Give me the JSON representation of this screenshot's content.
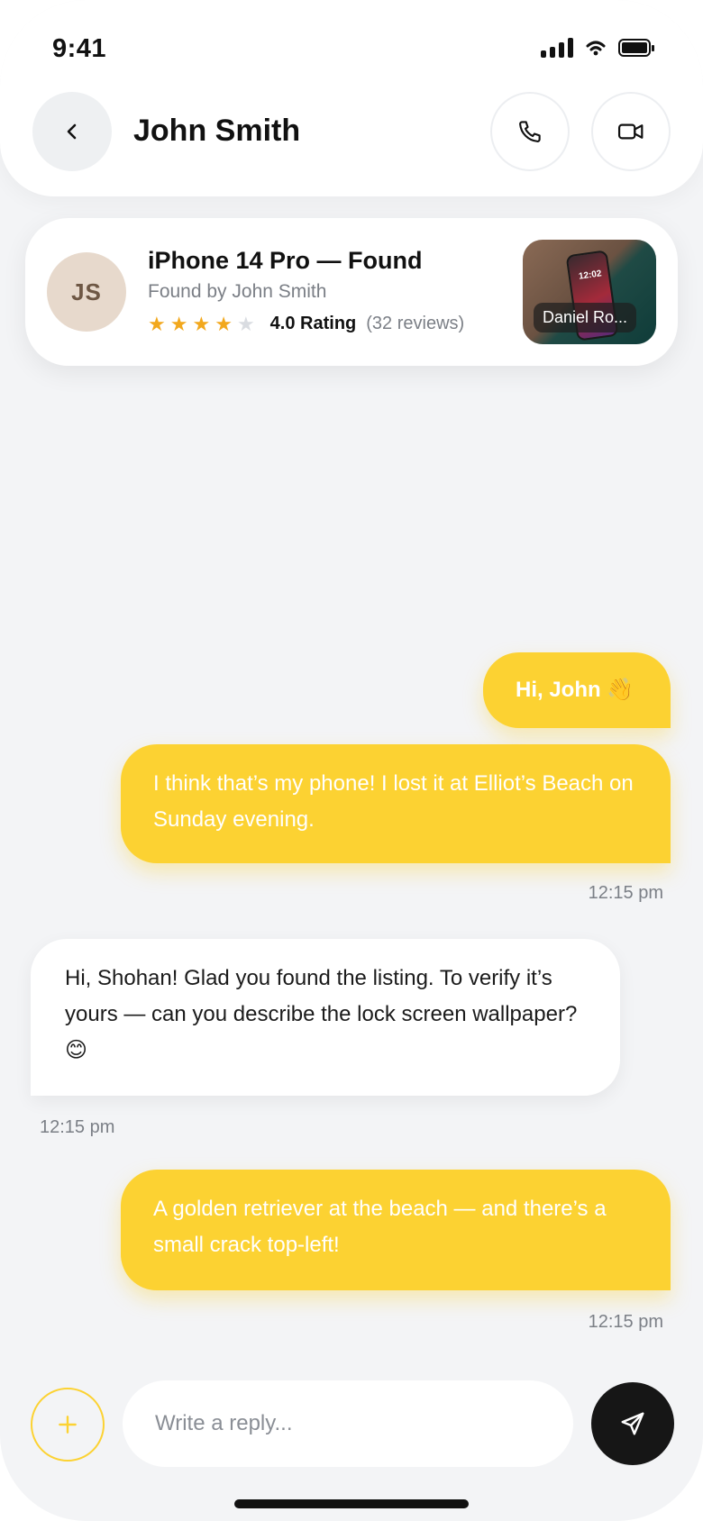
{
  "status": {
    "time": "9:41"
  },
  "header": {
    "contact_name": "John Smith"
  },
  "listing": {
    "avatar_initials": "JS",
    "title": "iPhone 14 Pro — Found",
    "subtitle": "Found by John Smith",
    "rating_value": 4,
    "rating_max": 5,
    "rating_text": "4.0 Rating",
    "reviews": "(32 reviews)",
    "thumb_time": "12:02",
    "thumb_label": "Daniel Ro..."
  },
  "messages": [
    {
      "from": "me",
      "text": "Hi, John 👋"
    },
    {
      "from": "me",
      "text": "I think that’s my phone! I lost it at Elliot’s Beach on Sunday evening.",
      "time": "12:15 pm"
    },
    {
      "from": "them",
      "text": "Hi, Shohan! Glad you found the listing. To verify it’s yours — can you describe the lock screen wallpaper? 😊",
      "time": "12:15 pm"
    },
    {
      "from": "me",
      "text": "A golden retriever at the beach — and there’s a small crack top-left!",
      "time": "12:15 pm"
    }
  ],
  "composer": {
    "placeholder": "Write a reply..."
  },
  "colors": {
    "accent": "#fcd232",
    "star": "#f2a81d",
    "send": "#161616"
  },
  "icons": {
    "back": "chevron-left-icon",
    "call": "phone-icon",
    "video": "video-camera-icon",
    "add": "plus-icon",
    "send": "send-icon"
  }
}
